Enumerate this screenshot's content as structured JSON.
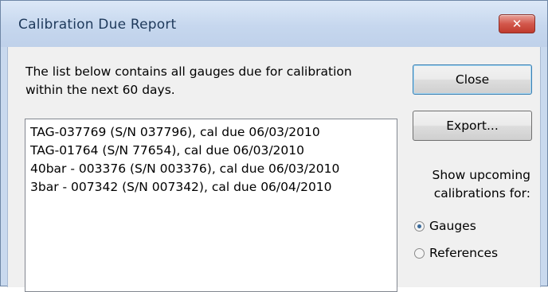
{
  "window": {
    "title": "Calibration Due Report",
    "close_glyph": "✕"
  },
  "intro_text": "The list below contains all gauges due for calibration\nwithin the next 60 days.",
  "gauge_list": [
    "TAG-037769 (S/N 037796), cal due 06/03/2010",
    "TAG-01764 (S/N 77654), cal due 06/03/2010",
    "40bar - 003376 (S/N 003376), cal due 06/03/2010",
    "3bar - 007342 (S/N 007342), cal due 06/04/2010"
  ],
  "buttons": {
    "close_label": "Close",
    "export_label": "Export..."
  },
  "upcoming": {
    "label": "Show upcoming\ncalibrations for:",
    "options": [
      {
        "label": "Gauges",
        "selected": true
      },
      {
        "label": "References",
        "selected": false
      }
    ]
  }
}
